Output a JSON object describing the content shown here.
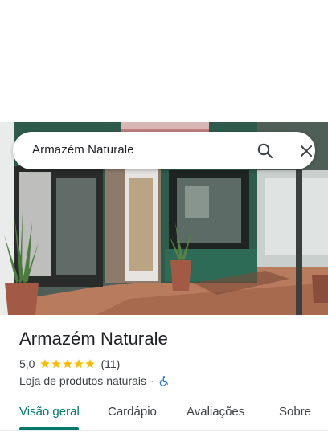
{
  "search": {
    "query": "Armazém Naturale"
  },
  "place": {
    "name": "Armazém Naturale",
    "rating": "5,0",
    "stars": 5,
    "review_count": "(11)",
    "category": "Loja de produtos naturais",
    "separator": "·"
  },
  "tabs": [
    {
      "label": "Visão geral",
      "active": true
    },
    {
      "label": "Cardápio",
      "active": false
    },
    {
      "label": "Avaliações",
      "active": false
    },
    {
      "label": "Sobre",
      "active": false
    }
  ],
  "colors": {
    "accent": "#00796b",
    "star": "#fbbc04",
    "accessibility": "#1a73e8"
  },
  "icons": [
    "search-icon",
    "close-icon",
    "star-icon",
    "wheelchair-accessible-icon"
  ]
}
